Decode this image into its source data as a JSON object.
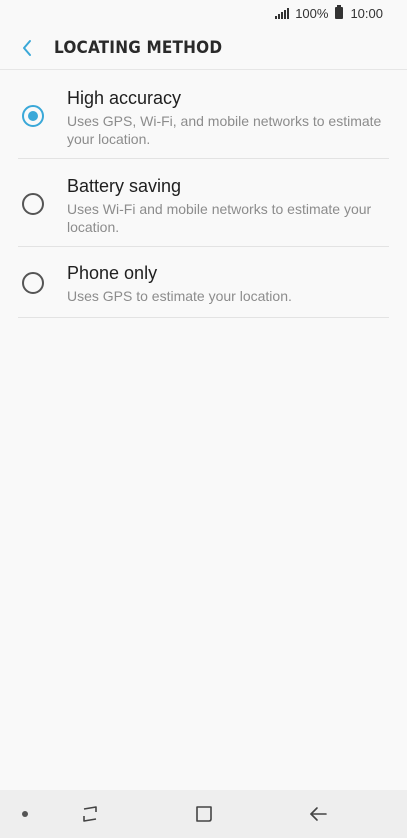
{
  "status_bar": {
    "battery_percent": "100%",
    "time": "10:00"
  },
  "header": {
    "title": "LOCATING METHOD",
    "back_icon": "chevron-left-icon"
  },
  "colors": {
    "accent": "#3aa8d8",
    "background": "#f9f9f9",
    "nav_background": "#eeeeee"
  },
  "options": [
    {
      "title": "High accuracy",
      "description": "Uses GPS, Wi-Fi, and mobile networks to estimate your location.",
      "selected": true
    },
    {
      "title": "Battery saving",
      "description": "Uses Wi-Fi and mobile networks to estimate your location.",
      "selected": false
    },
    {
      "title": "Phone only",
      "description": "Uses GPS to estimate your location.",
      "selected": false
    }
  ],
  "nav_bar": {
    "icons": [
      "dot-icon",
      "recent-apps-icon",
      "home-icon",
      "back-arrow-icon"
    ]
  }
}
